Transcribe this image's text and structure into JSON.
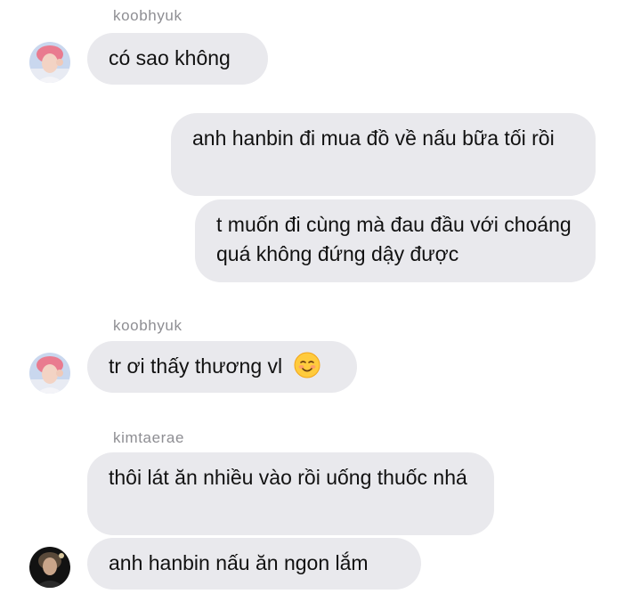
{
  "messages": [
    {
      "sender": "koobhyuk",
      "text": "có sao không"
    },
    {
      "text": "anh hanbin đi mua đồ về nấu bữa tối rồi"
    },
    {
      "text": "t muốn đi cùng mà đau đầu với choáng quá không đứng dậy được"
    },
    {
      "sender": "koobhyuk",
      "text": "tr ơi thấy thương vl",
      "emoji": "smiling-face-emoji"
    },
    {
      "sender": "kimtaerae",
      "text": "thôi lát ăn nhiều vào rồi uống thuốc nhá"
    },
    {
      "text": "anh hanbin nấu ăn ngon lắm"
    }
  ],
  "colors": {
    "bubble": "#e9e9ed",
    "sender_name": "#8e8e93",
    "text": "#111111",
    "background": "#ffffff"
  }
}
